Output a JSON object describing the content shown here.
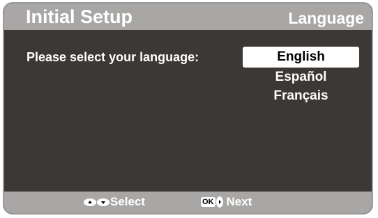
{
  "header": {
    "title": "Initial Setup",
    "section": "Language"
  },
  "main": {
    "prompt": "Please select your language:",
    "languages": [
      {
        "label": "English",
        "selected": true
      },
      {
        "label": "Español",
        "selected": false
      },
      {
        "label": "Français",
        "selected": false
      }
    ]
  },
  "footer": {
    "select_label": "Select",
    "next_label": "Next",
    "ok_key": "OK",
    "select_icons": [
      "up-arrow-icon",
      "down-arrow-icon"
    ],
    "next_icon": "right-arrow-icon"
  },
  "colors": {
    "background": "#3b3836",
    "bar": "#a9a7a5",
    "highlight": "#ffffff"
  }
}
